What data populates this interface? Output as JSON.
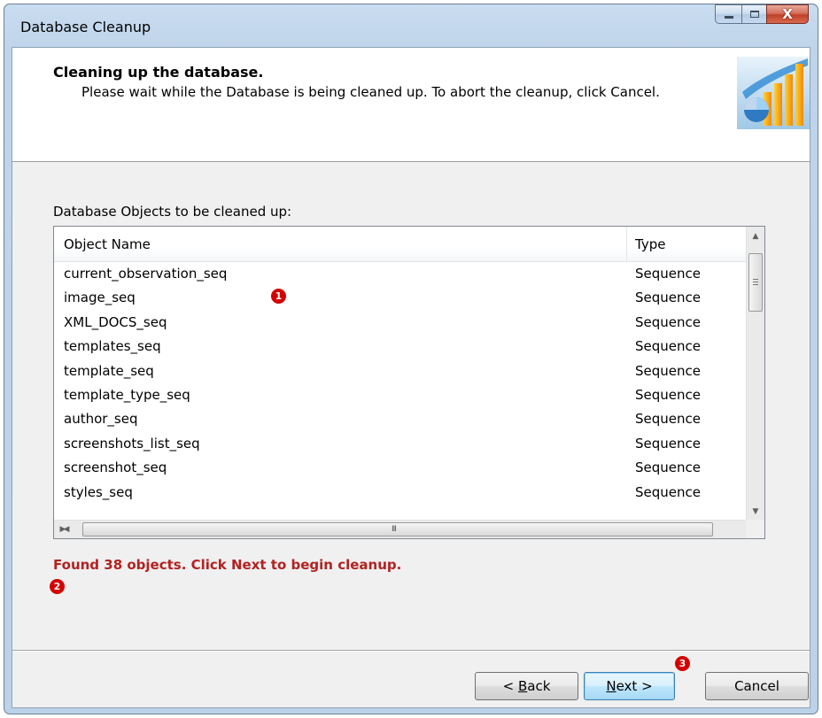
{
  "window": {
    "title": "Database Cleanup",
    "close_glyph": "X"
  },
  "header": {
    "title": "Cleaning up the database.",
    "subtitle": "Please wait while the Database is being cleaned up. To abort the cleanup, click Cancel.",
    "image_icon": "chart-icon"
  },
  "list": {
    "label": "Database Objects to be cleaned up:",
    "columns": [
      "Object Name",
      "Type"
    ],
    "rows": [
      {
        "name": "current_observation_seq",
        "type": "Sequence"
      },
      {
        "name": "image_seq",
        "type": "Sequence"
      },
      {
        "name": "XML_DOCS_seq",
        "type": "Sequence"
      },
      {
        "name": "templates_seq",
        "type": "Sequence"
      },
      {
        "name": "template_seq",
        "type": "Sequence"
      },
      {
        "name": "template_type_seq",
        "type": "Sequence"
      },
      {
        "name": "author_seq",
        "type": "Sequence"
      },
      {
        "name": "screenshots_list_seq",
        "type": "Sequence"
      },
      {
        "name": "screenshot_seq",
        "type": "Sequence"
      },
      {
        "name": "styles_seq",
        "type": "Sequence"
      }
    ],
    "hscroll_grip": "III"
  },
  "status": {
    "text": "Found 38 objects. Click Next to begin cleanup.",
    "color": "#b22222"
  },
  "markers": [
    "1",
    "2",
    "3"
  ],
  "buttons": {
    "back_prefix": "< ",
    "back_mnemonic": "B",
    "back_rest": "ack",
    "next_mnemonic": "N",
    "next_rest": "ext >",
    "cancel": "Cancel"
  }
}
